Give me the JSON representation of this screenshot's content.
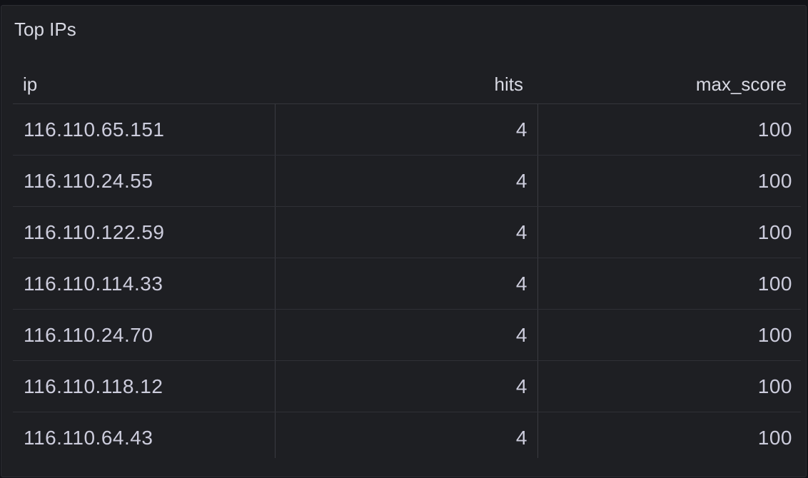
{
  "panel": {
    "title": "Top IPs"
  },
  "table": {
    "columns": [
      "ip",
      "hits",
      "max_score"
    ],
    "rows": [
      {
        "ip": "116.110.65.151",
        "hits": "4",
        "max_score": "100"
      },
      {
        "ip": "116.110.24.55",
        "hits": "4",
        "max_score": "100"
      },
      {
        "ip": "116.110.122.59",
        "hits": "4",
        "max_score": "100"
      },
      {
        "ip": "116.110.114.33",
        "hits": "4",
        "max_score": "100"
      },
      {
        "ip": "116.110.24.70",
        "hits": "4",
        "max_score": "100"
      },
      {
        "ip": "116.110.118.12",
        "hits": "4",
        "max_score": "100"
      },
      {
        "ip": "116.110.64.43",
        "hits": "4",
        "max_score": "100"
      }
    ]
  }
}
